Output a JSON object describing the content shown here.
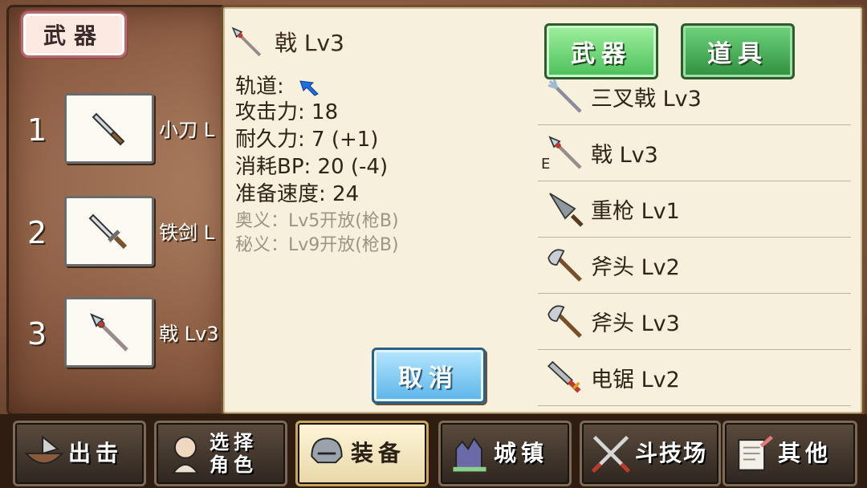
{
  "left": {
    "section_title": "武器",
    "slots": [
      {
        "num": "1",
        "label": "小刀 L"
      },
      {
        "num": "2",
        "label": "铁剑 L"
      },
      {
        "num": "3",
        "label": "戟 Lv3"
      }
    ]
  },
  "detail": {
    "title": "戟 Lv3",
    "orbit_label": "轨道:",
    "attack": "攻击力: 18",
    "durability": "耐久力: 7 (+1)",
    "bp": "消耗BP: 20 (-4)",
    "speed": "准备速度: 24",
    "ougi": "奥义：Lv5开放(枪B)",
    "higi": "秘义：Lv9开放(枪B)"
  },
  "tabs": {
    "weapon": "武器",
    "item": "道具"
  },
  "weapon_list": [
    {
      "name": "三叉戟 Lv3",
      "icon": "trident-icon",
      "equipped": ""
    },
    {
      "name": "戟 Lv3",
      "icon": "halberd-icon",
      "equipped": "E"
    },
    {
      "name": "重枪 Lv1",
      "icon": "heavy-lance-icon",
      "equipped": ""
    },
    {
      "name": "斧头 Lv2",
      "icon": "axe-icon",
      "equipped": ""
    },
    {
      "name": "斧头 Lv3",
      "icon": "axe-icon",
      "equipped": ""
    },
    {
      "name": "电锯 Lv2",
      "icon": "chainsaw-icon",
      "equipped": ""
    }
  ],
  "cancel": "取消",
  "nav": {
    "sortie": "出击",
    "select_char_line1": "选择",
    "select_char_line2": "角色",
    "equip": "装备",
    "town": "城镇",
    "arena": "斗技场",
    "other": "其他"
  },
  "colors": {
    "tab_green": "#4cbf5a",
    "cancel_blue": "#5ab4e8",
    "orbit_arrow": "#1f6fe0"
  }
}
